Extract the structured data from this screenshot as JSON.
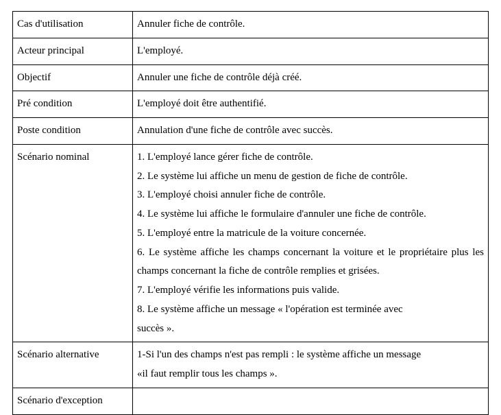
{
  "rows": {
    "use_case": {
      "label": "Cas d'utilisation",
      "value": "Annuler fiche de contrôle."
    },
    "actor": {
      "label": "Acteur principal",
      "value": "L'employé."
    },
    "objective": {
      "label": "Objectif",
      "value": "Annuler une fiche de contrôle déjà créé."
    },
    "precondition": {
      "label": "Pré condition",
      "value": "L'employé doit être authentifié."
    },
    "postcondition": {
      "label": "Poste condition",
      "value": "Annulation d'une fiche de contrôle avec succès."
    },
    "nominal": {
      "label": "Scénario nominal",
      "steps": [
        "1.  L'employé lance gérer fiche de contrôle.",
        "2.  Le système lui affiche un menu de gestion de fiche de contrôle.",
        "3. L'employé choisi annuler fiche de contrôle.",
        "4. Le système lui affiche le formulaire d'annuler une fiche de contrôle.",
        "5. L'employé entre la matricule de la voiture concernée.",
        "6. Le système affiche les champs concernant la voiture et le propriétaire plus les champs concernant la fiche de contrôle remplies et grisées.",
        "7. L'employé vérifie les informations puis valide.",
        "8. Le système affiche un message « l'opération est terminée avec",
        " succès »."
      ]
    },
    "alternative": {
      "label": "Scénario alternative",
      "line1": "1-Si l'un des champs n'est pas rempli : le système affiche un message",
      "line2": "«il faut remplir tous les champs »."
    },
    "exception": {
      "label": "Scénario d'exception",
      "value": ""
    }
  }
}
